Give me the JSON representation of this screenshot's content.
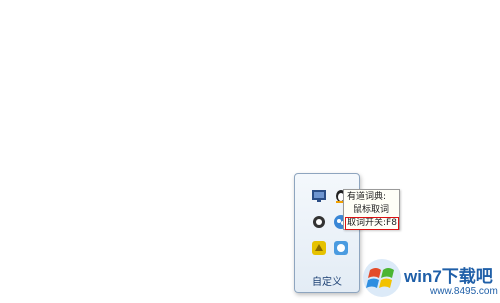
{
  "tray": {
    "customize_label": "自定义",
    "icons": [
      {
        "name": "network-monitor-icon",
        "color": "#2b4e86"
      },
      {
        "name": "qq-penguin-icon",
        "color": "#f2a100"
      },
      {
        "name": "rate-icon",
        "color": "#333333"
      },
      {
        "name": "youdao-dict-icon",
        "color": "#3a87d6"
      },
      {
        "name": "yellow-app-icon",
        "color": "#e6c200"
      },
      {
        "name": "blue-app-icon",
        "color": "#4a9be0"
      }
    ]
  },
  "tooltip": {
    "line1": "有道词典:",
    "line2": "鼠标取词",
    "line3": "取词开关:F8",
    "highlight_color": "#dd1111"
  },
  "watermark": {
    "title": "win7下载吧",
    "url": "www.8495.com"
  }
}
